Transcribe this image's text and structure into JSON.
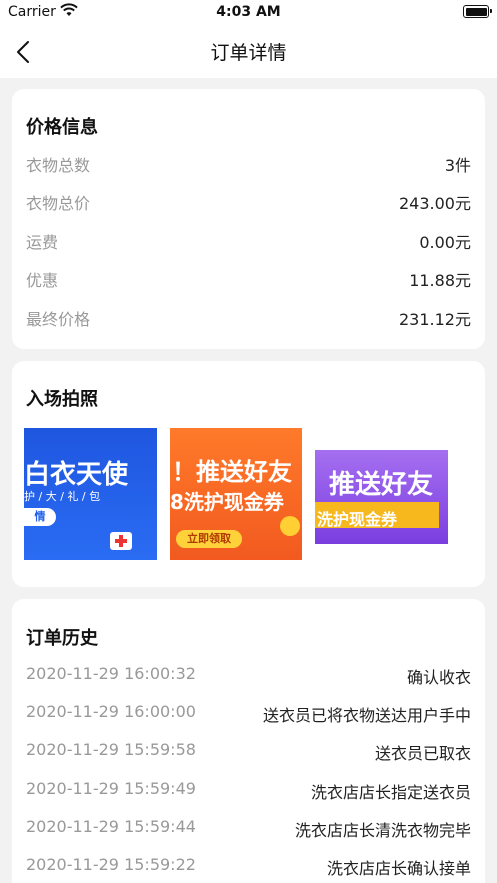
{
  "status_bar": {
    "carrier": "Carrier",
    "time": "4:03 AM"
  },
  "nav": {
    "title": "订单详情"
  },
  "price_info": {
    "title": "价格信息",
    "rows": [
      {
        "label": "衣物总数",
        "value": "3件"
      },
      {
        "label": "衣物总价",
        "value": "243.00元"
      },
      {
        "label": "运费",
        "value": "0.00元"
      },
      {
        "label": "优惠",
        "value": "11.88元"
      },
      {
        "label": "最终价格",
        "value": "231.12元"
      }
    ]
  },
  "photos": {
    "title": "入场拍照",
    "items": [
      {
        "text_main": "白衣天使",
        "text_sub": "护 / 大 / 礼 / 包",
        "button": "情",
        "color": "#2462ea"
      },
      {
        "text_main": "！推送好友",
        "text_sub": "8洗护现金券",
        "button": "立即领取",
        "color": "#f5622a"
      },
      {
        "text_main": "推送好友",
        "text_sub": "洗护现金券",
        "color": "#8a54e8"
      }
    ]
  },
  "history": {
    "title": "订单历史",
    "rows": [
      {
        "time": "2020-11-29 16:00:32",
        "event": "确认收衣"
      },
      {
        "time": "2020-11-29 16:00:00",
        "event": "送衣员已将衣物送达用户手中"
      },
      {
        "time": "2020-11-29 15:59:58",
        "event": "送衣员已取衣"
      },
      {
        "time": "2020-11-29 15:59:49",
        "event": "洗衣店店长指定送衣员"
      },
      {
        "time": "2020-11-29 15:59:44",
        "event": "洗衣店店长清洗衣物完毕"
      },
      {
        "time": "2020-11-29 15:59:22",
        "event": "洗衣店店长确认接单"
      }
    ]
  }
}
